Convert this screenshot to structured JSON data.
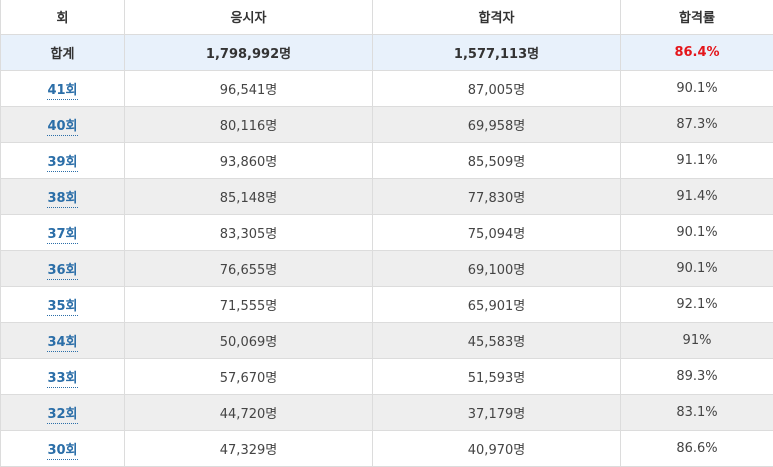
{
  "table": {
    "headers": [
      "회",
      "응시자",
      "합격자",
      "합격률"
    ],
    "total": {
      "label": "합계",
      "applicants": "1,798,992명",
      "passed": "1,577,113명",
      "rate": "86.4%"
    },
    "rows": [
      {
        "round": "41회",
        "applicants": "96,541명",
        "passed": "87,005명",
        "rate": "90.1%"
      },
      {
        "round": "40회",
        "applicants": "80,116명",
        "passed": "69,958명",
        "rate": "87.3%"
      },
      {
        "round": "39회",
        "applicants": "93,860명",
        "passed": "85,509명",
        "rate": "91.1%"
      },
      {
        "round": "38회",
        "applicants": "85,148명",
        "passed": "77,830명",
        "rate": "91.4%"
      },
      {
        "round": "37회",
        "applicants": "83,305명",
        "passed": "75,094명",
        "rate": "90.1%"
      },
      {
        "round": "36회",
        "applicants": "76,655명",
        "passed": "69,100명",
        "rate": "90.1%"
      },
      {
        "round": "35회",
        "applicants": "71,555명",
        "passed": "65,901명",
        "rate": "92.1%"
      },
      {
        "round": "34회",
        "applicants": "50,069명",
        "passed": "45,583명",
        "rate": "91%"
      },
      {
        "round": "33회",
        "applicants": "57,670명",
        "passed": "51,593명",
        "rate": "89.3%"
      },
      {
        "round": "32회",
        "applicants": "44,720명",
        "passed": "37,179명",
        "rate": "83.1%"
      },
      {
        "round": "30회",
        "applicants": "47,329명",
        "passed": "40,970명",
        "rate": "86.6%"
      }
    ]
  },
  "colors": {
    "link": "#2b6ea8",
    "total_rate": "#e4161b",
    "total_bg": "#e8f1fb",
    "alt_bg": "#eeeeee"
  }
}
